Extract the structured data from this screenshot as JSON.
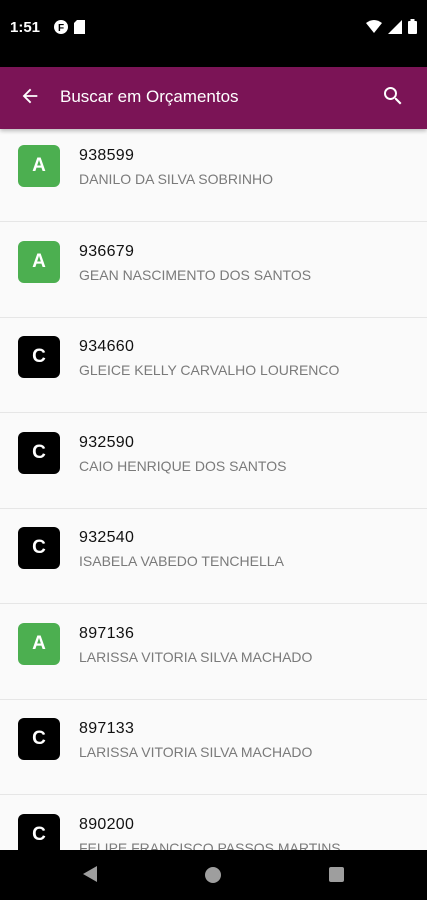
{
  "status_bar": {
    "time": "1:51",
    "icons": [
      "notification-f-icon",
      "sd-card-icon",
      "wifi-icon",
      "cellular-signal-icon",
      "battery-icon"
    ]
  },
  "app_bar": {
    "title": "Buscar em Orçamentos",
    "back_icon": "arrow-left-icon",
    "search_icon": "search-icon",
    "color": "#7b1456"
  },
  "colors": {
    "status_A": "#4caf50",
    "status_C": "#000000"
  },
  "items": [
    {
      "status": "A",
      "number": "938599",
      "name": "DANILO DA SILVA SOBRINHO"
    },
    {
      "status": "A",
      "number": "936679",
      "name": "GEAN NASCIMENTO DOS SANTOS"
    },
    {
      "status": "C",
      "number": "934660",
      "name": "GLEICE KELLY CARVALHO LOURENCO"
    },
    {
      "status": "C",
      "number": "932590",
      "name": "CAIO HENRIQUE DOS SANTOS"
    },
    {
      "status": "C",
      "number": "932540",
      "name": "ISABELA VABEDO TENCHELLA"
    },
    {
      "status": "A",
      "number": "897136",
      "name": "LARISSA VITORIA SILVA MACHADO"
    },
    {
      "status": "C",
      "number": "897133",
      "name": "LARISSA VITORIA SILVA MACHADO"
    },
    {
      "status": "C",
      "number": "890200",
      "name": "FELIPE FRANCISCO PASSOS MARTINS"
    }
  ],
  "nav_bar": {
    "icons": [
      "nav-back-icon",
      "nav-home-icon",
      "nav-recents-icon"
    ]
  }
}
